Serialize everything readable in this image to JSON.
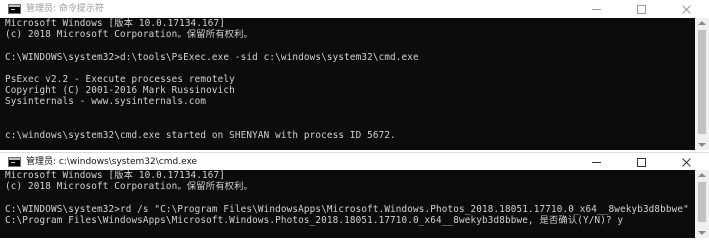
{
  "windows": [
    {
      "title": "管理员: 命令提示符",
      "lines": [
        "Microsoft Windows [版本 10.0.17134.167]",
        "(c) 2018 Microsoft Corporation。保留所有权利。",
        "",
        "C:\\WINDOWS\\system32>d:\\tools\\PsExec.exe -sid c:\\windows\\system32\\cmd.exe",
        "",
        "PsExec v2.2 - Execute processes remotely",
        "Copyright (C) 2001-2016 Mark Russinovich",
        "Sysinternals - www.sysinternals.com",
        "",
        "",
        "c:\\windows\\system32\\cmd.exe started on SHENYAN with process ID 5672."
      ]
    },
    {
      "title": "管理员: c:\\windows\\system32\\cmd.exe",
      "lines": [
        "Microsoft Windows [版本 10.0.17134.167]",
        "(c) 2018 Microsoft Corporation。保留所有权利。",
        "",
        "C:\\WINDOWS\\system32>rd /s \"C:\\Program Files\\WindowsApps\\Microsoft.Windows.Photos_2018.18051.17710.0_x64__8wekyb3d8bbwe\"",
        "C:\\Program Files\\WindowsApps\\Microsoft.Windows.Photos_2018.18051.17710.0_x64__8wekyb3d8bbwe, 是否确认(Y/N)? y"
      ]
    }
  ],
  "colors": {
    "console_bg": "#0c0c0c",
    "console_fg": "#d2d2d2",
    "titlebar_bg": "#ffffff"
  },
  "icons": {
    "app": "cmd-icon",
    "minimize": "minimize-icon",
    "maximize": "maximize-icon",
    "close": "close-icon"
  }
}
